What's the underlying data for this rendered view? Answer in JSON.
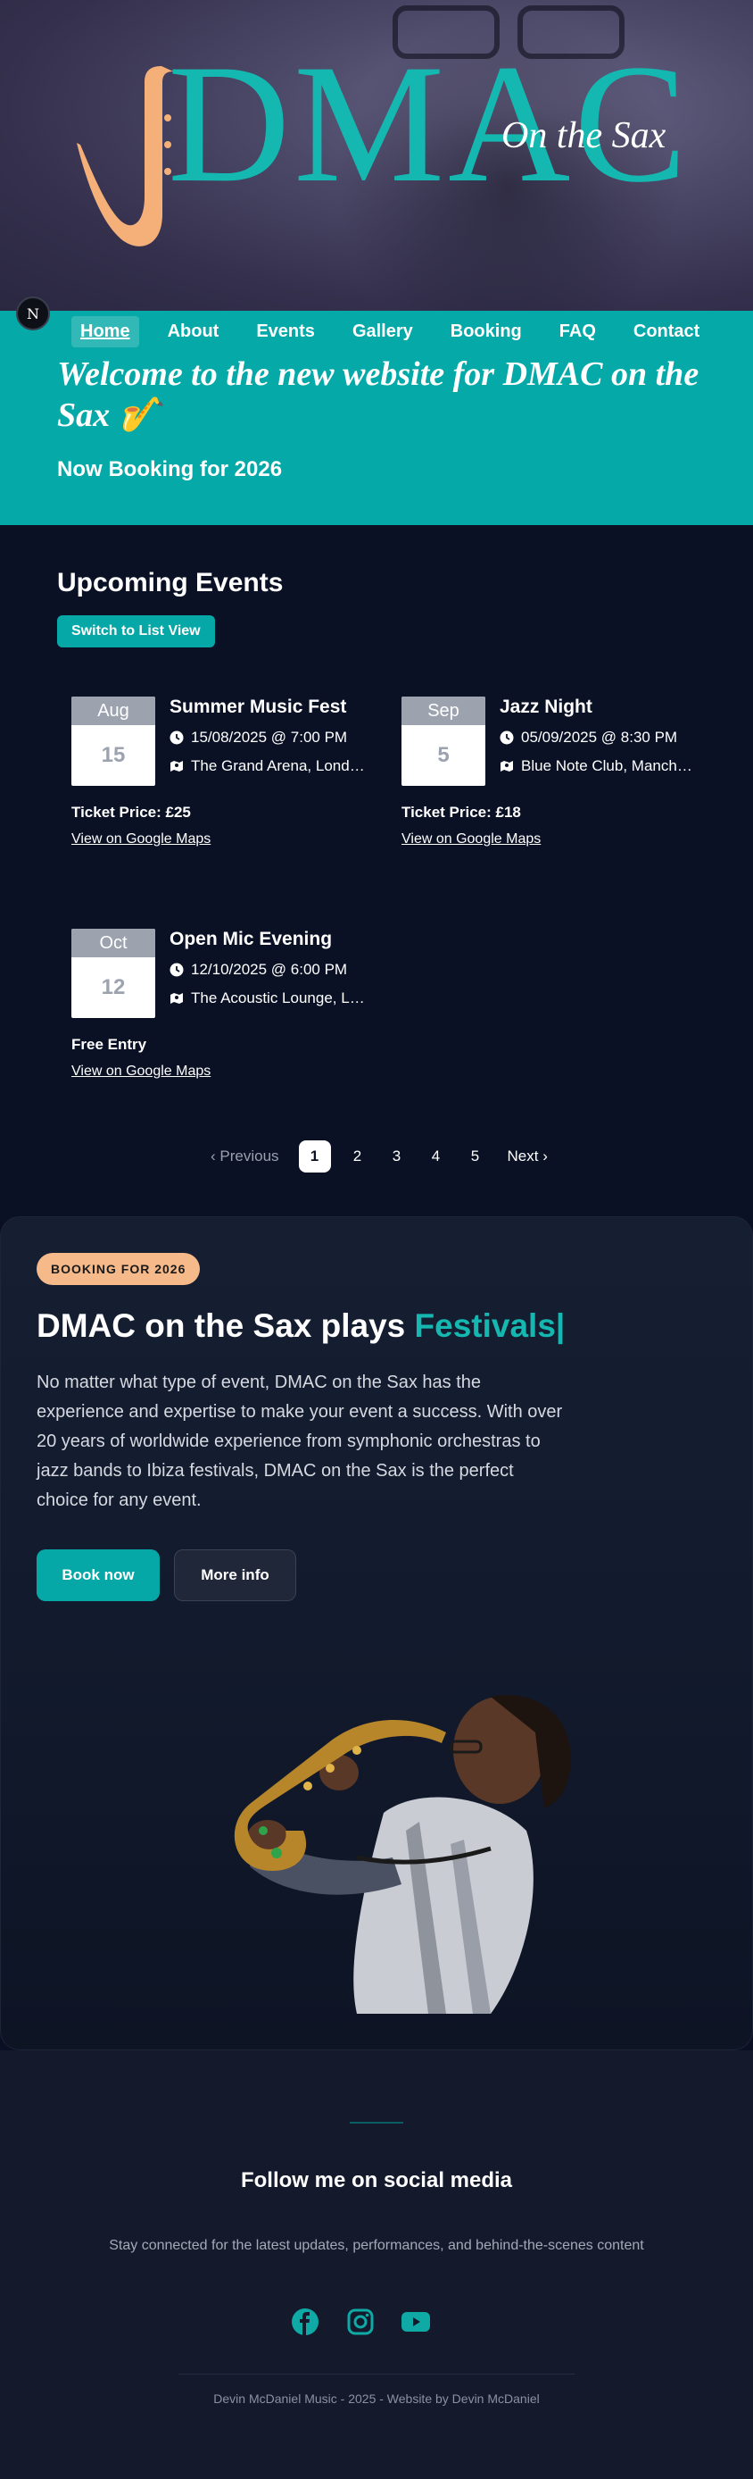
{
  "hero": {
    "logo_text": "DMAC",
    "logo_tagline": "On the Sax"
  },
  "avatar": {
    "letter": "N"
  },
  "nav": {
    "items": [
      {
        "label": "Home",
        "active": true
      },
      {
        "label": "About"
      },
      {
        "label": "Events"
      },
      {
        "label": "Gallery"
      },
      {
        "label": "Booking"
      },
      {
        "label": "FAQ"
      },
      {
        "label": "Contact"
      }
    ]
  },
  "welcome": {
    "title": "Welcome to the new website for DMAC on the Sax 🎷",
    "subtitle": "Now Booking for 2026"
  },
  "events": {
    "title": "Upcoming Events",
    "switch_label": "Switch to List View",
    "map_link": "View on Google Maps",
    "items": [
      {
        "month": "Aug",
        "day": "15",
        "name": "Summer Music Fest",
        "datetime": "15/08/2025 @ 7:00 PM",
        "venue": "The Grand Arena, London",
        "price": "Ticket Price: £25"
      },
      {
        "month": "Sep",
        "day": "5",
        "name": "Jazz Night",
        "datetime": "05/09/2025 @ 8:30 PM",
        "venue": "Blue Note Club, Manchester",
        "price": "Ticket Price: £18"
      },
      {
        "month": "Oct",
        "day": "12",
        "name": "Open Mic Evening",
        "datetime": "12/10/2025 @ 6:00 PM",
        "venue": "The Acoustic Lounge, Leeds",
        "price": "Free Entry"
      }
    ]
  },
  "pagination": {
    "prev": "Previous",
    "pages": [
      "1",
      "2",
      "3",
      "4",
      "5"
    ],
    "current": "1",
    "next": "Next"
  },
  "booking": {
    "badge": "BOOKING FOR 2026",
    "heading_main": "DMAC on the Sax plays ",
    "heading_accent": "Festivals|",
    "body": "No matter what type of event, DMAC on the Sax has the experience and expertise to make your event a success. With over 20 years of worldwide experience from symphonic orchestras to jazz bands to Ibiza festivals, DMAC on the Sax is the perfect choice for any event.",
    "book_now": "Book now",
    "more_info": "More info"
  },
  "footer": {
    "follow": "Follow me on social media",
    "stay": "Stay connected for the latest updates, performances, and behind-the-scenes content",
    "copyright": "Devin McDaniel Music - 2025 - Website by Devin McDaniel",
    "socials": [
      "facebook-icon",
      "instagram-icon",
      "youtube-icon"
    ]
  },
  "colors": {
    "accent": "#04a9a8",
    "badge": "#f5b98a",
    "background": "#0a0f24"
  }
}
